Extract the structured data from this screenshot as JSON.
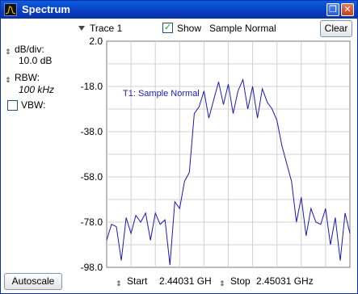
{
  "window": {
    "title": "Spectrum"
  },
  "toolbar": {
    "trace_label": "Trace 1",
    "show_label": "Show",
    "show_checked": true,
    "mode_label": "Sample Normal",
    "clear_label": "Clear"
  },
  "left_panel": {
    "db_div_label": "dB/div:",
    "db_div_value": "10.0 dB",
    "rbw_label": "RBW:",
    "rbw_value": "100 kHz",
    "vbw_label": "VBW:",
    "vbw_checked": false,
    "autoscale_label": "Autoscale"
  },
  "footer": {
    "start_label": "Start",
    "start_value": "2.44031 GH",
    "stop_label": "Stop",
    "stop_value": "2.45031 GHz"
  },
  "chart_data": {
    "type": "line",
    "ylim": [
      -98.0,
      2.0
    ],
    "y_ticks": [
      "2.0",
      "-18.0",
      "-38.0",
      "-58.0",
      "-78.0",
      "-98.0"
    ],
    "y_tick_values": [
      2.0,
      -18.0,
      -38.0,
      -58.0,
      -78.0,
      -98.0
    ],
    "x_start": "2.44031 GHz",
    "x_stop": "2.45031 GHz",
    "x_divisions": 10,
    "grid": true,
    "trace_color": "#1a1ab4",
    "series": [
      {
        "name": "T1: Sample Normal",
        "x": [
          0,
          0.02,
          0.04,
          0.06,
          0.08,
          0.1,
          0.12,
          0.14,
          0.16,
          0.18,
          0.2,
          0.22,
          0.24,
          0.26,
          0.28,
          0.3,
          0.32,
          0.34,
          0.36,
          0.38,
          0.4,
          0.42,
          0.44,
          0.46,
          0.48,
          0.5,
          0.52,
          0.54,
          0.56,
          0.58,
          0.6,
          0.62,
          0.64,
          0.66,
          0.68,
          0.7,
          0.72,
          0.74,
          0.76,
          0.78,
          0.8,
          0.82,
          0.84,
          0.86,
          0.88,
          0.9,
          0.92,
          0.94,
          0.96,
          0.98,
          1.0
        ],
        "y": [
          -86,
          -79,
          -80,
          -95,
          -76,
          -83,
          -75,
          -78,
          -74,
          -86,
          -74,
          -79,
          -77,
          -97,
          -69,
          -72,
          -60,
          -56,
          -30,
          -27,
          -20,
          -32,
          -24,
          -16,
          -26,
          -17,
          -30,
          -20,
          -15,
          -28,
          -18,
          -32,
          -19,
          -25,
          -28,
          -33,
          -44,
          -52,
          -60,
          -78,
          -67,
          -84,
          -72,
          -78,
          -79,
          -72,
          -88,
          -76,
          -95,
          -74,
          -83
        ]
      }
    ]
  }
}
